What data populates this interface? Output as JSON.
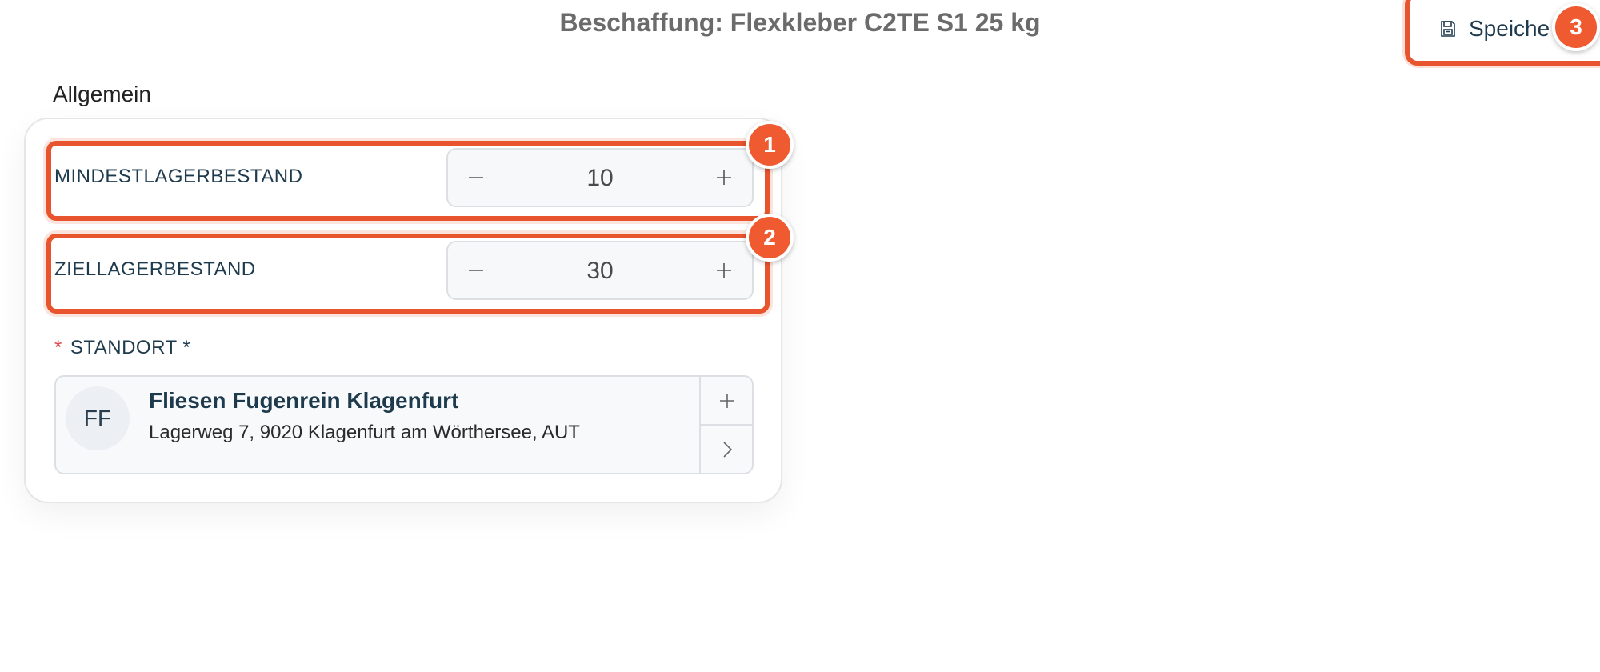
{
  "header": {
    "title": "Beschaffung: Flexkleber C2TE S1 25 kg",
    "save_label": "Speiche",
    "save_icon": "floppy-disk-icon"
  },
  "badges": [
    "1",
    "2",
    "3"
  ],
  "section": {
    "heading": "Allgemein"
  },
  "fields": {
    "min_stock": {
      "label": "MINDESTLAGERBESTAND",
      "value": "10"
    },
    "target_stock": {
      "label": "ZIELLAGERBESTAND",
      "value": "30"
    }
  },
  "location": {
    "required_marker": "*",
    "label": "STANDORT *",
    "avatar_initials": "FF",
    "name": "Fliesen Fugenrein Klagenfurt",
    "address": "Lagerweg 7, 9020 Klagenfurt am Wörthersee, AUT"
  },
  "colors": {
    "highlight": "#e8542d",
    "badge": "#ef5a31",
    "text_dark": "#1e3a4d",
    "required": "#e5484d"
  }
}
